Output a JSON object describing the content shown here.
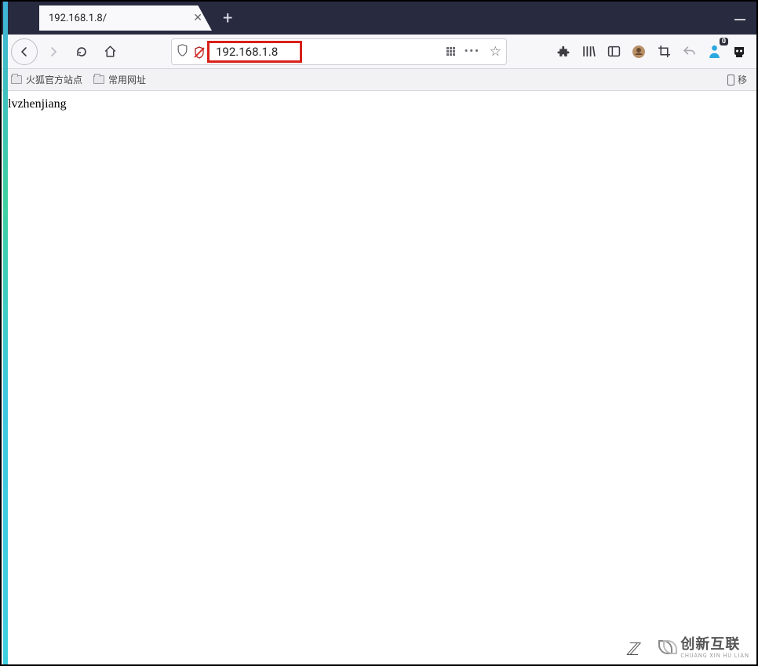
{
  "tab": {
    "title": "192.168.1.8/",
    "close_glyph": "✕",
    "newtab_glyph": "+"
  },
  "nav": {
    "back_glyph": "←",
    "forward_glyph": "→",
    "reload_glyph": "↻",
    "home_glyph": "⌂"
  },
  "address": {
    "url_text": "192.168.1.8",
    "menu_dots": "•••",
    "star_glyph": "☆"
  },
  "toolbar_right": {
    "badge_count": "0"
  },
  "bookmarks": {
    "items": [
      {
        "label": "火狐官方站点"
      },
      {
        "label": "常用网址"
      }
    ],
    "mobile_label": "移"
  },
  "page": {
    "body_text": "lvzhenjiang"
  },
  "watermark": {
    "brand_cn": "创新互联",
    "brand_en": "CHUANG XIN HU LIAN"
  }
}
